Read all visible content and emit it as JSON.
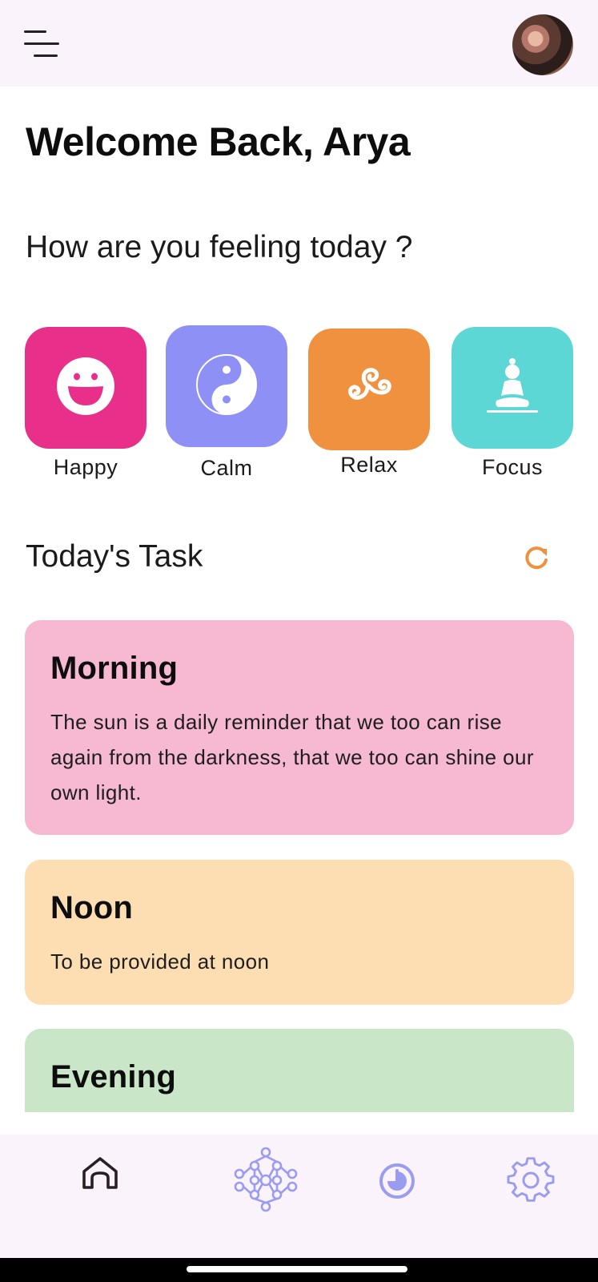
{
  "header": {
    "menu_icon": "hamburger-menu-icon",
    "avatar_icon": "user-avatar"
  },
  "greeting": {
    "welcome": "Welcome Back, Arya",
    "question": "How are you feeling today ?"
  },
  "moods": [
    {
      "label": "Happy",
      "icon": "smiley-icon",
      "color": "#E8308A"
    },
    {
      "label": "Calm",
      "icon": "yin-yang-icon",
      "color": "#8E90F5"
    },
    {
      "label": "Relax",
      "icon": "triskelion-icon",
      "color": "#F0913F"
    },
    {
      "label": "Focus",
      "icon": "meditation-icon",
      "color": "#5DD6D6"
    }
  ],
  "tasks": {
    "title": "Today's Task",
    "refresh_icon": "refresh-icon",
    "refresh_color": "#F0913F",
    "items": [
      {
        "title": "Morning",
        "text": "The sun is a daily reminder that we too can rise again from the darkness, that we too can shine our own light.",
        "color": "#F7B8D2"
      },
      {
        "title": "Noon",
        "text": "To be provided at noon",
        "color": "#FDDEB2"
      },
      {
        "title": "Evening",
        "text": "",
        "color": "#C9E6C9"
      }
    ]
  },
  "bottom_nav": [
    {
      "icon": "home-icon",
      "active": true
    },
    {
      "icon": "network-icon",
      "active": false
    },
    {
      "icon": "timer-icon",
      "active": false
    },
    {
      "icon": "settings-icon",
      "active": false
    }
  ]
}
